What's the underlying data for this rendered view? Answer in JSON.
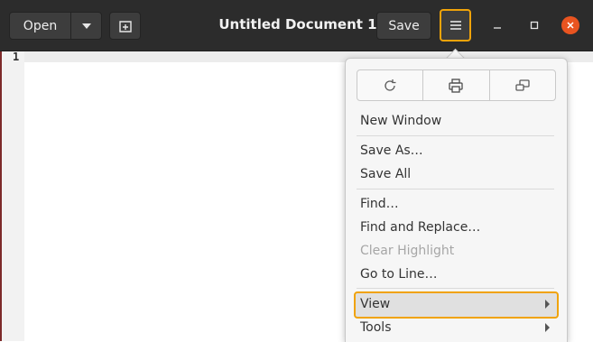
{
  "header": {
    "open_label": "Open",
    "title": "Untitled Document 1",
    "save_label": "Save"
  },
  "editor": {
    "line_number": "1"
  },
  "menu": {
    "icons": [
      "reload-icon",
      "print-icon",
      "fullscreen-icon"
    ],
    "items": {
      "new_window": "New Window",
      "save_as": "Save As…",
      "save_all": "Save All",
      "find": "Find…",
      "find_replace": "Find and Replace…",
      "clear_highlight": "Clear Highlight",
      "go_to_line": "Go to Line…",
      "view": "View",
      "tools": "Tools"
    }
  },
  "colors": {
    "header_bg": "#2c2c2c",
    "accent_highlight": "#f0a30a",
    "close_button": "#e95420"
  }
}
